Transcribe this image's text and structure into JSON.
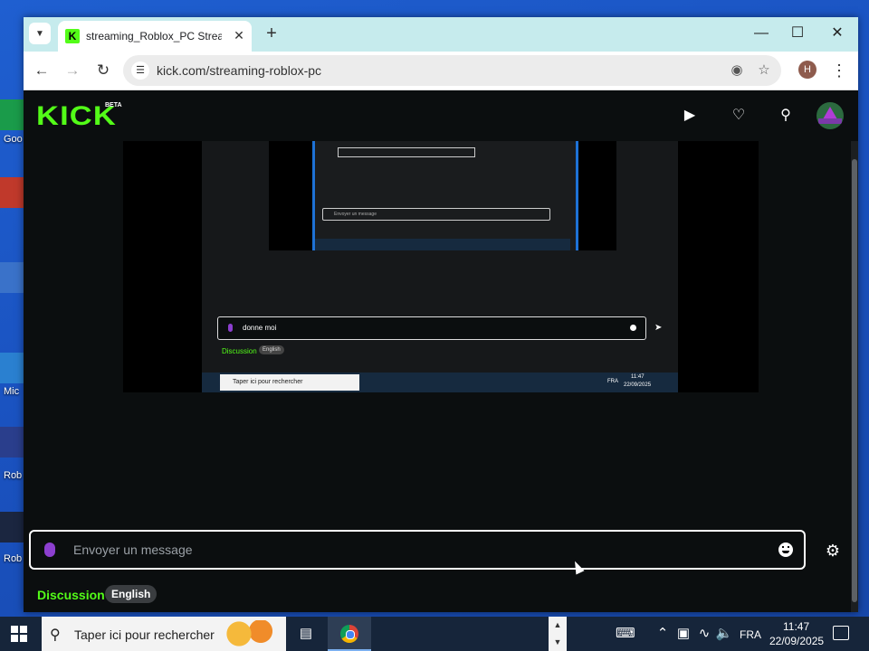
{
  "desktop": {
    "labels": [
      "Goo",
      "Mic",
      "Rob",
      "Rob"
    ]
  },
  "browser": {
    "tab_title": "streaming_Roblox_PC Stream -",
    "url": "kick.com/streaming-roblox-pc",
    "profile_initial": "H"
  },
  "kick": {
    "logo": "KICK",
    "beta": "BETA",
    "chat": {
      "placeholder": "Envoyer un message",
      "discussion_label": "Discussion",
      "language_badge": "English"
    },
    "stream_preview": {
      "typed_message": "donne moi",
      "discussion_label": "Discussion",
      "language_badge": "English",
      "nested_placeholder": "Envoyer un message",
      "taskbar_search": "Taper ici pour rechercher",
      "tray_lang": "FRA",
      "tray_time": "11:47",
      "tray_date": "22/09/2025"
    }
  },
  "taskbar": {
    "search_placeholder": "Taper ici pour rechercher",
    "lang": "FRA",
    "time": "11:47",
    "date": "22/09/2025"
  },
  "colors": {
    "kick_green": "#53fc18",
    "tab_strip": "#c6ebed",
    "page_bg": "#0b0e0f",
    "taskbar": "#16253a"
  }
}
